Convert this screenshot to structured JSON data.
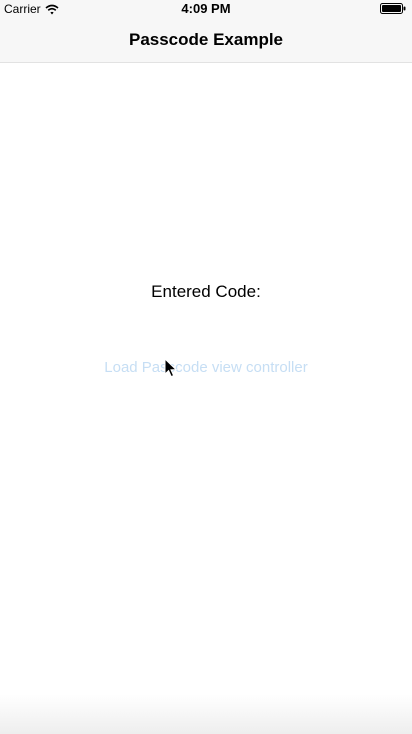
{
  "status_bar": {
    "carrier": "Carrier",
    "time": "4:09 PM",
    "wifi_icon": "wifi-icon",
    "battery_icon": "battery-icon"
  },
  "nav_bar": {
    "title": "Passcode Example"
  },
  "main": {
    "entered_code_label": "Entered Code:",
    "load_button_label": "Load Passcode view controller",
    "load_button_color": "#c6def4",
    "cursor_icon": "mouse-pointer-icon"
  }
}
